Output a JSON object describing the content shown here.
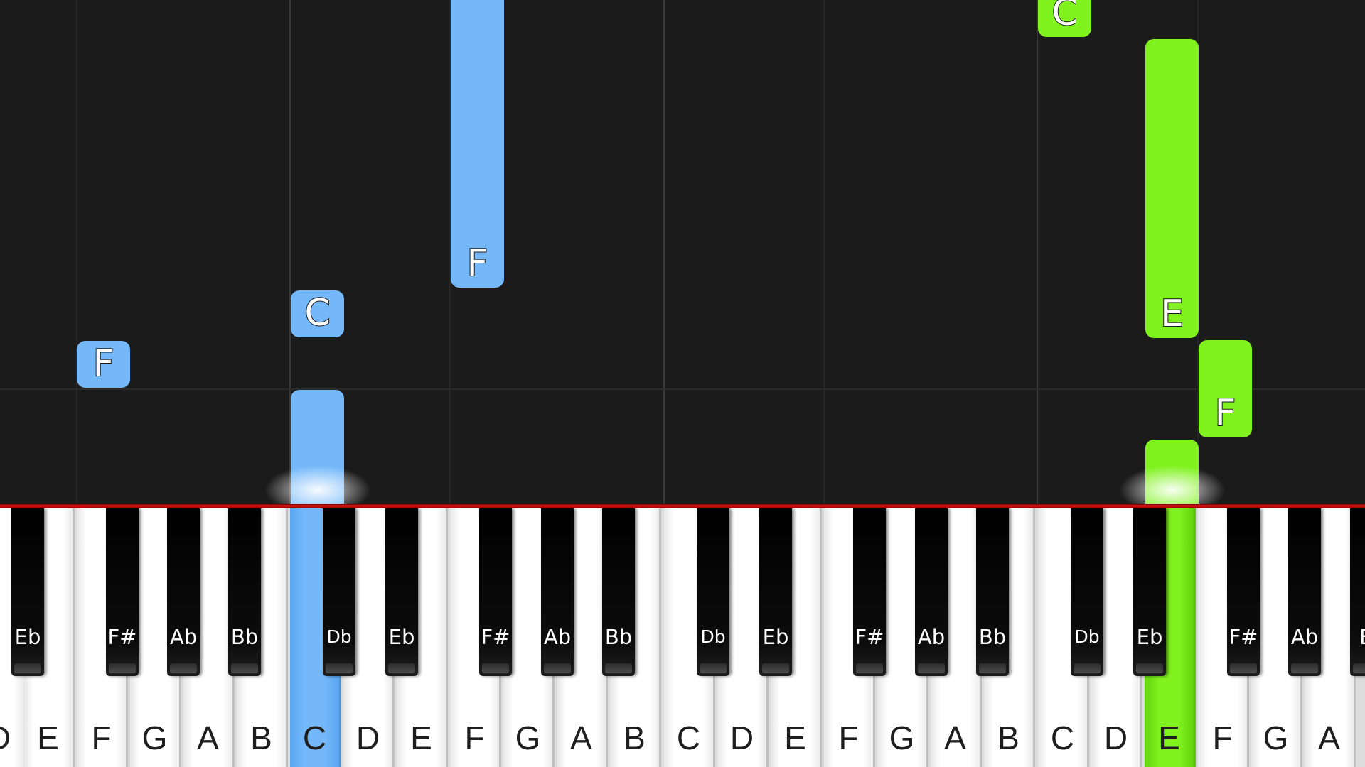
{
  "colors": {
    "hand_left": "#74b8fa",
    "hand_right": "#80f21e",
    "background": "#1b1b1b",
    "hit_line": "#e01818"
  },
  "roll": {
    "notes": [
      {
        "id": "note-f-1",
        "label": "F",
        "color": "blue"
      },
      {
        "id": "note-c-1",
        "label": "C",
        "color": "blue"
      },
      {
        "id": "note-f-2",
        "label": "F",
        "color": "blue"
      },
      {
        "id": "note-c-playing",
        "label": "",
        "color": "blue"
      },
      {
        "id": "note-c-2",
        "label": "C",
        "color": "green"
      },
      {
        "id": "note-e-1",
        "label": "E",
        "color": "green"
      },
      {
        "id": "note-f-3",
        "label": "F",
        "color": "green"
      },
      {
        "id": "note-e-playing",
        "label": "",
        "color": "green"
      }
    ]
  },
  "keyboard": {
    "white_keys": [
      "D",
      "E",
      "F",
      "G",
      "A",
      "B",
      "C",
      "D",
      "E",
      "F",
      "G",
      "A",
      "B",
      "C",
      "D",
      "E",
      "F",
      "G",
      "A",
      "B",
      "C",
      "D",
      "E",
      "F",
      "G",
      "A"
    ],
    "black_keys": [
      "Eb",
      "F#",
      "Ab",
      "Bb",
      "Db",
      "Eb",
      "F#",
      "Ab",
      "Bb",
      "Db",
      "Eb",
      "F#",
      "Ab",
      "Bb",
      "Db",
      "Eb",
      "F#",
      "Ab",
      "B"
    ],
    "pressed": [
      {
        "key": "C",
        "hand": "left"
      },
      {
        "key": "E",
        "hand": "right"
      }
    ]
  }
}
